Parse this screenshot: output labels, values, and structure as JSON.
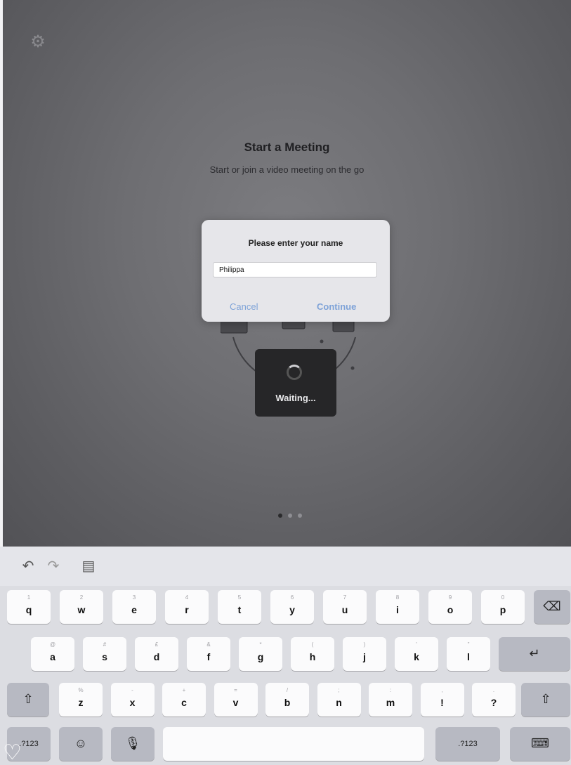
{
  "status_bar": {
    "left": "",
    "right": ""
  },
  "header": {
    "settings_icon": "gear-icon"
  },
  "intro": {
    "title": "Start a Meeting",
    "subtitle": "Start or join a video meeting on the go"
  },
  "dialog": {
    "title": "Please enter your name",
    "name_value": "Philippa",
    "cancel_label": "Cancel",
    "continue_label": "Continue"
  },
  "waiting": {
    "label": "Waiting..."
  },
  "pager": {
    "count": 3,
    "active_index": 0
  },
  "toolbar": {
    "undo_icon": "undo-icon",
    "redo_icon": "redo-icon",
    "paste_icon": "paste-icon"
  },
  "keyboard": {
    "row1": [
      {
        "key": "q",
        "hint": "1"
      },
      {
        "key": "w",
        "hint": "2"
      },
      {
        "key": "e",
        "hint": "3"
      },
      {
        "key": "r",
        "hint": "4"
      },
      {
        "key": "t",
        "hint": "5"
      },
      {
        "key": "y",
        "hint": "6"
      },
      {
        "key": "u",
        "hint": "7"
      },
      {
        "key": "i",
        "hint": "8"
      },
      {
        "key": "o",
        "hint": "9"
      },
      {
        "key": "p",
        "hint": "0"
      }
    ],
    "row2": [
      {
        "key": "a",
        "hint": "@"
      },
      {
        "key": "s",
        "hint": "#"
      },
      {
        "key": "d",
        "hint": "£"
      },
      {
        "key": "f",
        "hint": "&"
      },
      {
        "key": "g",
        "hint": "*"
      },
      {
        "key": "h",
        "hint": "("
      },
      {
        "key": "j",
        "hint": ")"
      },
      {
        "key": "k",
        "hint": "'"
      },
      {
        "key": "l",
        "hint": "\""
      }
    ],
    "row3": [
      {
        "key": "z",
        "hint": "%"
      },
      {
        "key": "x",
        "hint": "-"
      },
      {
        "key": "c",
        "hint": "+"
      },
      {
        "key": "v",
        "hint": "="
      },
      {
        "key": "b",
        "hint": "/"
      },
      {
        "key": "n",
        "hint": ";"
      },
      {
        "key": "m",
        "hint": ":"
      },
      {
        "key": "!",
        "hint": ","
      },
      {
        "key": "?",
        "hint": "."
      }
    ],
    "numbers_label_left": ".?123",
    "numbers_label_right": ".?123",
    "delete_icon": "delete-icon",
    "return_icon": "return-icon",
    "shift_icon": "shift-icon",
    "emoji_icon": "emoji-icon",
    "mic_icon": "microphone-icon",
    "dismiss_icon": "keyboard-dismiss-icon"
  }
}
